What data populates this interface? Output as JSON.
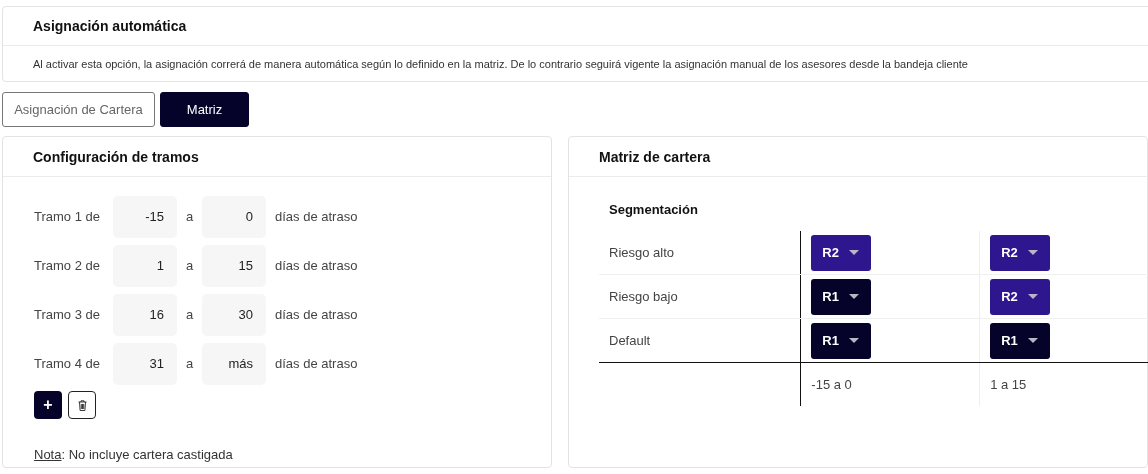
{
  "header": {
    "title": "Asignación automática",
    "description": "Al activar esta opción, la asignación correrá de manera automática según lo definido en la matriz. De lo contrario seguirá vigente la asignación manual de los asesores desde la bandeja cliente"
  },
  "tabs": [
    {
      "label": "Asignación de Cartera",
      "selected": false
    },
    {
      "label": "Matriz",
      "selected": true
    }
  ],
  "tramos": {
    "title": "Configuración de tramos",
    "rows": [
      {
        "label": "Tramo 1 de",
        "from": "-15",
        "joiner": "a",
        "to": "0",
        "suffix": "días de atraso"
      },
      {
        "label": "Tramo 2 de",
        "from": "1",
        "joiner": "a",
        "to": "15",
        "suffix": "días de atraso"
      },
      {
        "label": "Tramo 3 de",
        "from": "16",
        "joiner": "a",
        "to": "30",
        "suffix": "días de atraso"
      },
      {
        "label": "Tramo 4 de",
        "from": "31",
        "joiner": "a",
        "to": "más",
        "suffix": "días de atraso"
      }
    ],
    "add_button": "+",
    "note": {
      "link": "Nota",
      "text": ": No incluye cartera castigada"
    }
  },
  "matrix": {
    "title": "Matriz de cartera",
    "segment_heading": "Segmentación",
    "rows": [
      {
        "label": "Riesgo alto",
        "cells": [
          {
            "value": "R2",
            "color": "#2e168f"
          },
          {
            "value": "R2",
            "color": "#2e168f"
          }
        ]
      },
      {
        "label": "Riesgo bajo",
        "cells": [
          {
            "value": "R1",
            "color": "#05032a"
          },
          {
            "value": "R2",
            "color": "#2e168f"
          }
        ]
      },
      {
        "label": "Default",
        "cells": [
          {
            "value": "R1",
            "color": "#05032a"
          },
          {
            "value": "R1",
            "color": "#05032a"
          }
        ]
      }
    ],
    "range_labels": [
      "-15 a 0",
      "1 a 15"
    ]
  }
}
